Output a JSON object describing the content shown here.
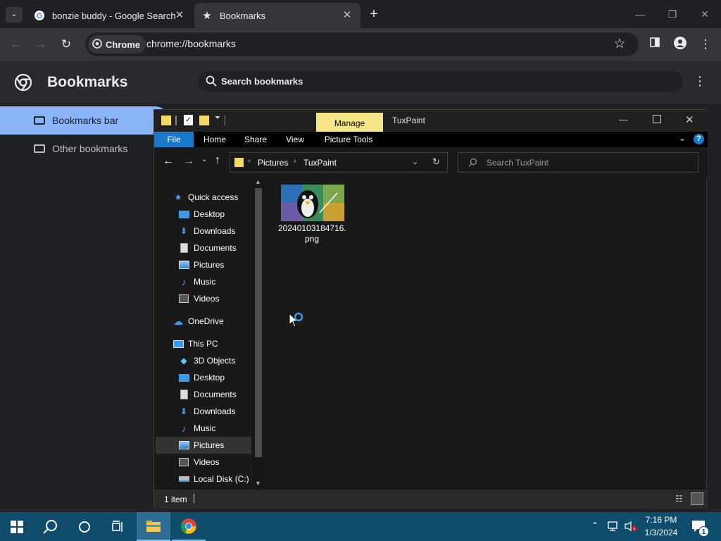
{
  "chrome": {
    "tabs": [
      {
        "title": "bonzie buddy - Google Search",
        "active": false
      },
      {
        "title": "Bookmarks",
        "active": true
      }
    ],
    "chip_label": "Chrome",
    "url": "chrome://bookmarks"
  },
  "bookmarks": {
    "title": "Bookmarks",
    "search_placeholder": "Search bookmarks",
    "folders": [
      "Bookmarks bar",
      "Other bookmarks"
    ]
  },
  "explorer": {
    "title": "TuxPaint",
    "contextual_tab": "Manage",
    "ribbon_tabs": [
      "File",
      "Home",
      "Share",
      "View",
      "Picture Tools"
    ],
    "breadcrumb": [
      "Pictures",
      "TuxPaint"
    ],
    "search_placeholder": "Search TuxPaint",
    "nav": {
      "quick_access": "Quick access",
      "quick_items": [
        "Desktop",
        "Downloads",
        "Documents",
        "Pictures",
        "Music",
        "Videos"
      ],
      "onedrive": "OneDrive",
      "this_pc": "This PC",
      "pc_items": [
        "3D Objects",
        "Desktop",
        "Documents",
        "Downloads",
        "Music",
        "Pictures",
        "Videos",
        "Local Disk (C:)"
      ]
    },
    "file": {
      "name_line1": "20240103184716.",
      "name_line2": "png"
    },
    "status": "1 item"
  },
  "taskbar": {
    "time": "7:16 PM",
    "date": "1/3/2024",
    "notification_count": "1"
  },
  "colors": {
    "chrome_bg": "#202124",
    "chrome_toolbar": "#35363a",
    "accent_blue": "#8ab4f8",
    "file_tab_blue": "#1979ca",
    "manage_yellow": "#f5e785",
    "taskbar": "#104d6d"
  }
}
